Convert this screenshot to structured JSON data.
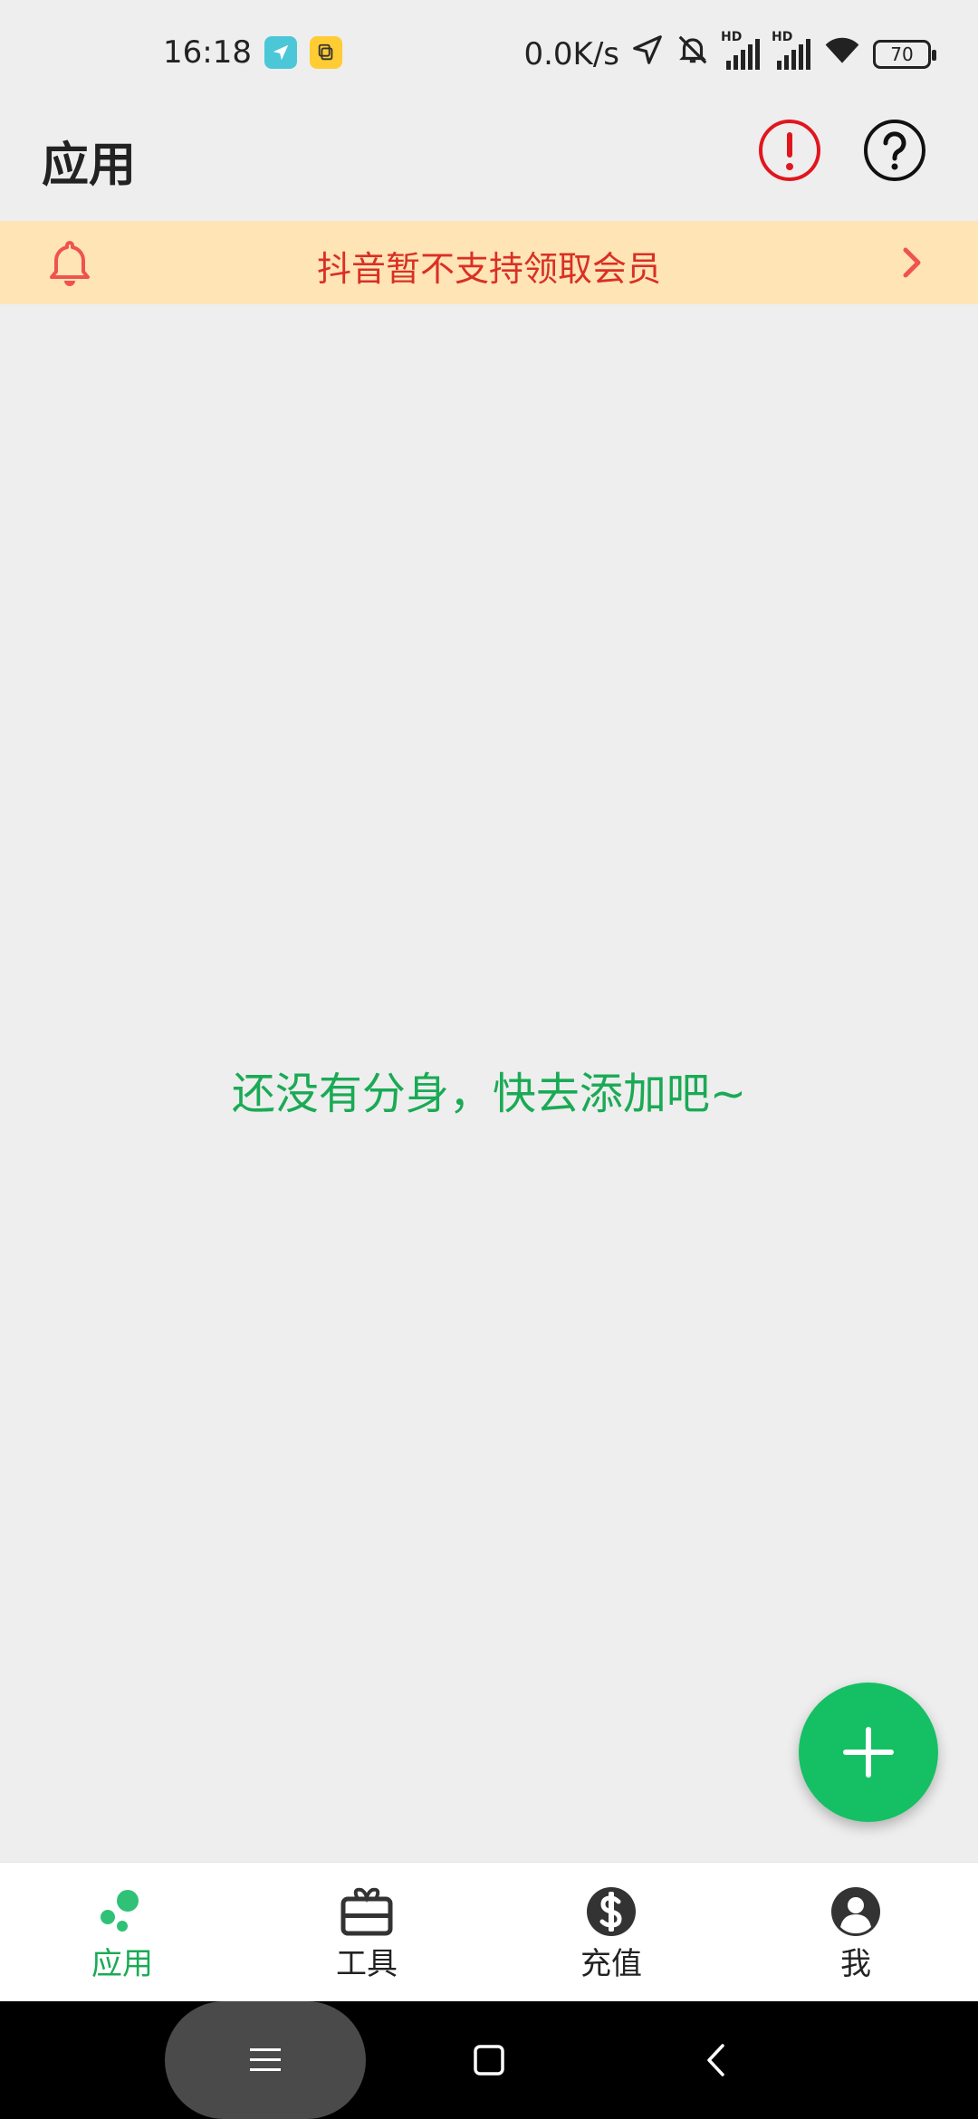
{
  "status_bar": {
    "time": "16:18",
    "network_speed": "0.0K/s",
    "battery": "70",
    "icons": [
      "navigation-app-icon",
      "clipboard-app-icon",
      "location-icon",
      "mute-bell-icon",
      "hd-signal-icon",
      "hd-signal-icon",
      "wifi-icon",
      "battery-icon"
    ],
    "hd_label": "HD"
  },
  "header": {
    "title": "应用",
    "icons": [
      "alert-icon",
      "help-icon"
    ]
  },
  "notice": {
    "text": "抖音暂不支持领取会员",
    "icon": "bell-icon",
    "color": "#d93025",
    "background": "#ffe4b5"
  },
  "empty_state": {
    "text": "还没有分身，快去添加吧~",
    "color": "#1aaa55"
  },
  "fab": {
    "icon": "plus-icon",
    "color": "#14c063"
  },
  "bottom_nav": {
    "items": [
      {
        "label": "应用",
        "icon": "apps-dots-icon",
        "active": true
      },
      {
        "label": "工具",
        "icon": "toolbox-icon",
        "active": false
      },
      {
        "label": "充值",
        "icon": "dollar-icon",
        "active": false
      },
      {
        "label": "我",
        "icon": "user-icon",
        "active": false
      }
    ],
    "active_color": "#1aaa55"
  },
  "system_nav": {
    "buttons": [
      "menu-icon",
      "home-icon",
      "back-icon"
    ]
  }
}
